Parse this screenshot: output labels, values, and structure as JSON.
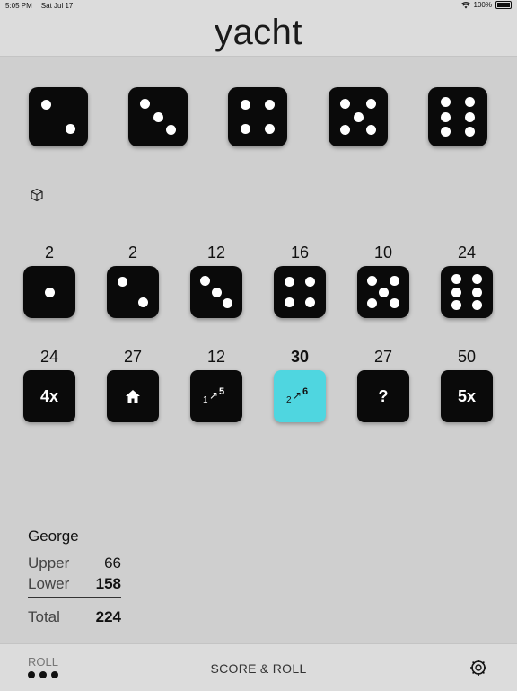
{
  "status": {
    "time": "5:05 PM",
    "date": "Sat Jul 17",
    "battery": "100%"
  },
  "title": "yacht",
  "roll_dice": [
    2,
    3,
    4,
    5,
    6
  ],
  "groups": [
    {
      "score": "2",
      "face": 1,
      "bold": false
    },
    {
      "score": "2",
      "face": 2,
      "bold": false
    },
    {
      "score": "12",
      "face": 3,
      "bold": false
    },
    {
      "score": "16",
      "face": 4,
      "bold": false
    },
    {
      "score": "10",
      "face": 5,
      "bold": false
    },
    {
      "score": "24",
      "face": 6,
      "bold": false
    }
  ],
  "categories": [
    {
      "score": "24",
      "label": "4x",
      "kind": "text",
      "selected": false
    },
    {
      "score": "27",
      "label": "",
      "kind": "house-icon",
      "selected": false
    },
    {
      "score": "12",
      "label": "1↗5",
      "kind": "seq-small",
      "selected": false
    },
    {
      "score": "30",
      "label": "2↗6",
      "kind": "seq-large",
      "selected": true
    },
    {
      "score": "27",
      "label": "?",
      "kind": "text",
      "selected": false
    },
    {
      "score": "50",
      "label": "5x",
      "kind": "text",
      "selected": false
    }
  ],
  "player": {
    "name": "George",
    "upper_label": "Upper",
    "upper": "66",
    "lower_label": "Lower",
    "lower": "158",
    "total_label": "Total",
    "total": "224"
  },
  "footer": {
    "roll_label": "ROLL",
    "action": "SCORE & ROLL"
  },
  "colors": {
    "selected": "#4fd6e0",
    "die": "#0a0a0a",
    "background": "#cfcfcf"
  }
}
